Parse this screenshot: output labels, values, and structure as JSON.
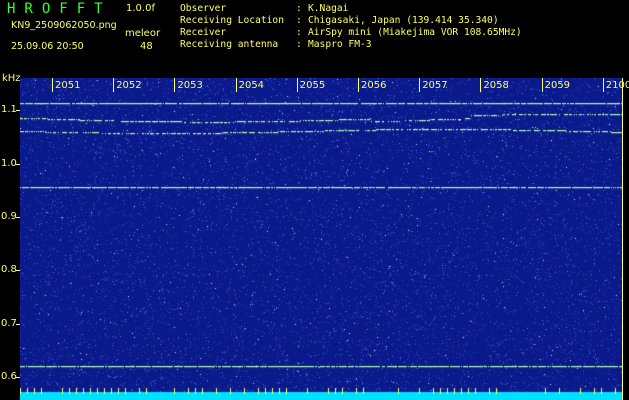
{
  "header": {
    "logo": "HROFFT",
    "version": "1.0.0f",
    "filename": "KN9_2509062050.png",
    "kind": "meleor",
    "datetime": "25.09.06 20:50",
    "count": "48",
    "fields": [
      {
        "key": "Observer",
        "value": "K.Nagai"
      },
      {
        "key": "Receiving Location",
        "value": "Chigasaki, Japan (139.414 35.340)"
      },
      {
        "key": "Receiver",
        "value": "AirSpy mini (Miakejima VOR 108.65MHz)"
      },
      {
        "key": "Receiving antenna",
        "value": "Maspro FM-3"
      }
    ]
  },
  "spectrogram": {
    "y_unit": "kHz",
    "y_ticks": [
      "1.1",
      "1.0",
      "0.9",
      "0.8",
      "0.7",
      "0.6"
    ],
    "x_ticks": [
      "2051",
      "2052",
      "2053",
      "2054",
      "2055",
      "2056",
      "2057",
      "2058",
      "2059",
      "2100"
    ],
    "ylim": [
      0.58,
      1.16
    ],
    "traces_khz": [
      1.112,
      1.085,
      1.06,
      0.956,
      0.62
    ],
    "colors": {
      "background": "#0a1a8a",
      "speckle": "#4a7cff",
      "trace": "#b8ffb0",
      "bottom_band": "#00e0ff",
      "axis_text": "#ffff66"
    }
  }
}
